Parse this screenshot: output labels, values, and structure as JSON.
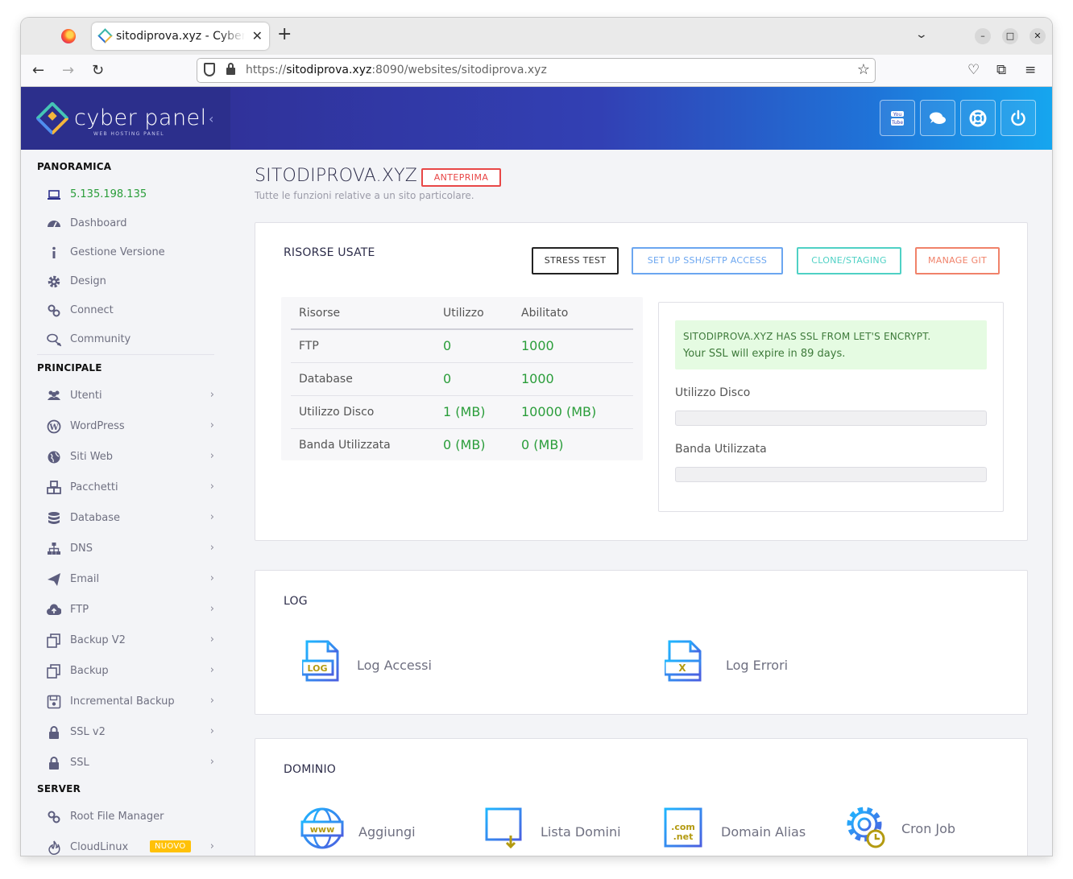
{
  "browser": {
    "tab_title": "sitodiprova.xyz - CyberPanel",
    "tab_close": "✕",
    "new_tab": "+",
    "url_protocol": "https://",
    "url_host": "sitodiprova.xyz",
    "url_path": ":8090/websites/sitodiprova.xyz"
  },
  "brand": {
    "name": "cyber panel",
    "tagline": "WEB HOSTING PANEL",
    "collapse": "‹"
  },
  "sidebar": {
    "sections": {
      "overview": "PANORAMICA",
      "main": "PRINCIPALE",
      "server": "SERVER"
    },
    "ip_address": "5.135.198.135",
    "overview_items": [
      {
        "label": "Dashboard",
        "icon": "dashboard-icon"
      },
      {
        "label": "Gestione Versione",
        "icon": "info-icon"
      },
      {
        "label": "Design",
        "icon": "gear-icon"
      },
      {
        "label": "Connect",
        "icon": "link-icon"
      },
      {
        "label": "Community",
        "icon": "chat-icon"
      }
    ],
    "main_items": [
      {
        "label": "Utenti",
        "icon": "users-icon"
      },
      {
        "label": "WordPress",
        "icon": "wordpress-icon"
      },
      {
        "label": "Siti Web",
        "icon": "globe-icon"
      },
      {
        "label": "Pacchetti",
        "icon": "cubes-icon"
      },
      {
        "label": "Database",
        "icon": "database-icon"
      },
      {
        "label": "DNS",
        "icon": "sitemap-icon"
      },
      {
        "label": "Email",
        "icon": "paper-plane-icon"
      },
      {
        "label": "FTP",
        "icon": "cloud-upload-icon"
      },
      {
        "label": "Backup V2",
        "icon": "copy-icon"
      },
      {
        "label": "Backup",
        "icon": "copy-icon"
      },
      {
        "label": "Incremental Backup",
        "icon": "save-icon"
      },
      {
        "label": "SSL v2",
        "icon": "lock-icon"
      },
      {
        "label": "SSL",
        "icon": "lock-icon"
      }
    ],
    "server_items": [
      {
        "label": "Root File Manager",
        "icon": "link-icon"
      },
      {
        "label": "CloudLinux",
        "icon": "fire-icon",
        "badge": "NUOVO"
      }
    ],
    "chevron": "›"
  },
  "page": {
    "title": "SITODIPROVA.XYZ -",
    "preview_badge": "ANTEPRIMA",
    "subtitle": "Tutte le funzioni relative a un sito particolare."
  },
  "resources": {
    "title": "RISORSE USATE",
    "buttons": {
      "stress_test": "STRESS TEST",
      "ssh": "SET UP SSH/SFTP ACCESS",
      "clone": "CLONE/STAGING",
      "git": "MANAGE GIT"
    },
    "table_headers": [
      "Risorse",
      "Utilizzo",
      "Abilitato"
    ],
    "rows": [
      {
        "name": "FTP",
        "used": "0",
        "allowed": "1000"
      },
      {
        "name": "Database",
        "used": "0",
        "allowed": "1000"
      },
      {
        "name": "Utilizzo Disco",
        "used": "1 (MB)",
        "allowed": "10000 (MB)"
      },
      {
        "name": "Banda Utilizzata",
        "used": "0 (MB)",
        "allowed": "0 (MB)"
      }
    ],
    "ssl": {
      "line1": "SITODIPROVA.XYZ HAS SSL FROM LET'S ENCRYPT.",
      "line2": "Your SSL will expire in 89 days."
    },
    "disk_label": "Utilizzo Disco",
    "disk_fraction": 0.0,
    "bandwidth_label": "Banda Utilizzata",
    "bandwidth_fraction": 0.0
  },
  "log": {
    "title": "LOG",
    "access": "Log Accessi",
    "access_icon_text": "LOG",
    "errors": "Log Errori",
    "errors_icon_text": "X"
  },
  "domain": {
    "title": "DOMINIO",
    "add": "Aggiungi",
    "add_icon_text": "www",
    "list": "Lista Domini",
    "alias": "Domain Alias",
    "alias_icon_text": ".com\n.net",
    "cron": "Cron Job"
  },
  "colors": {
    "accent_green": "#2a9d3a",
    "preview_red": "#e84747",
    "ssh_blue": "#6ba6f0",
    "clone_teal": "#4fd1c5",
    "git_orange": "#f0826a",
    "nuovo_yellow": "#ffc107"
  }
}
